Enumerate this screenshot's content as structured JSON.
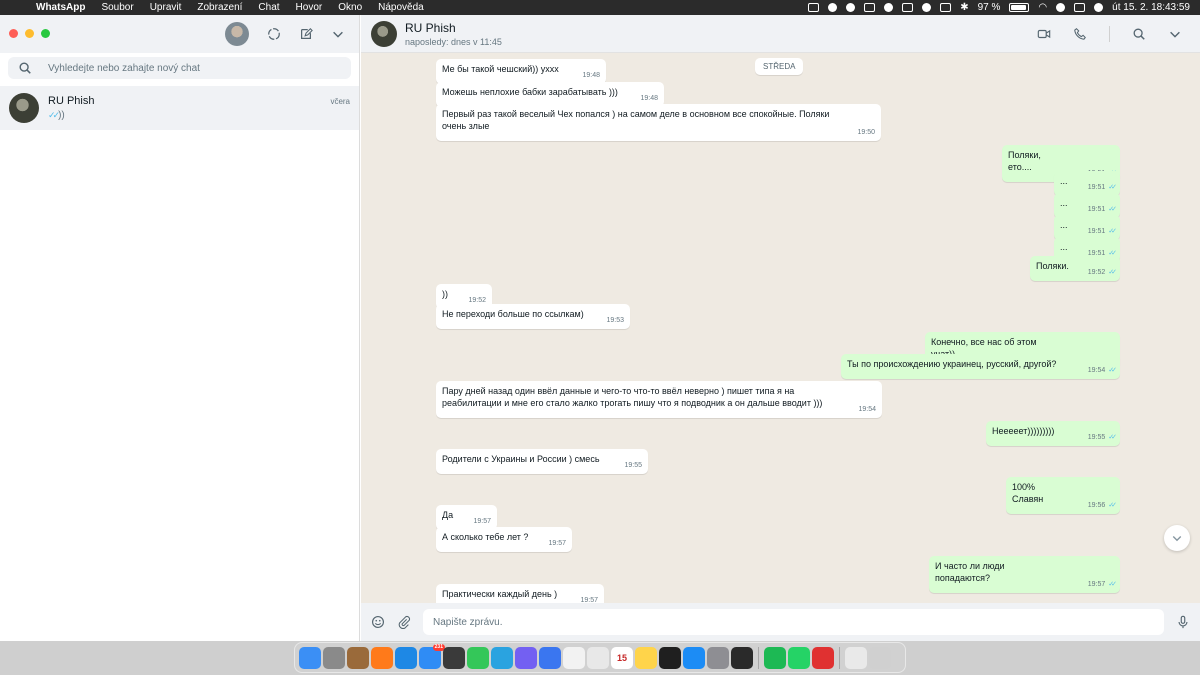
{
  "menubar": {
    "app": "WhatsApp",
    "items": [
      "Soubor",
      "Upravit",
      "Zobrazení",
      "Chat",
      "Hovor",
      "Okno",
      "Nápověda"
    ],
    "battery": "97 %",
    "datetime": "út 15. 2.  18:43:59"
  },
  "sidebar": {
    "search_placeholder": "Vyhledejte nebo zahajte nový chat",
    "chats": [
      {
        "name": "RU Phish",
        "time": "včera",
        "ticks": "✓✓",
        "preview": "))"
      }
    ]
  },
  "chat": {
    "contact_name": "RU Phish",
    "contact_status": "naposledy: dnes v 11:45",
    "day_separator": "STŘEDA",
    "composer_placeholder": "Napište zprávu.",
    "messages": [
      {
        "dir": "in",
        "text": "Ме бы такой чешский)) ухxx",
        "time": "19:48"
      },
      {
        "dir": "in",
        "text": "Можешь неплохие бабки зарабатывать )))",
        "time": "19:48"
      },
      {
        "dir": "in",
        "text": "Первый раз такой веселый Чех попался ) на самом деле в основном все спокойные. Поляки очень злые",
        "time": "19:50"
      },
      {
        "dir": "out",
        "text": "Поляки, ето....",
        "time": "19:51",
        "ticks": "✓✓"
      },
      {
        "dir": "out",
        "text": "...",
        "time": "19:51",
        "ticks": "✓✓"
      },
      {
        "dir": "out",
        "text": "...",
        "time": "19:51",
        "ticks": "✓✓"
      },
      {
        "dir": "out",
        "text": "...",
        "time": "19:51",
        "ticks": "✓✓"
      },
      {
        "dir": "out",
        "text": "...",
        "time": "19:51",
        "ticks": "✓✓"
      },
      {
        "dir": "out",
        "text": "Поляки.",
        "time": "19:52",
        "ticks": "✓✓"
      },
      {
        "dir": "in",
        "text": "))",
        "time": "19:52"
      },
      {
        "dir": "in",
        "text": "Не переходи больше по ссылкам)",
        "time": "19:53"
      },
      {
        "dir": "out",
        "text": "Конечно, все нас об этом учат))",
        "time": "19:54",
        "ticks": "✓✓"
      },
      {
        "dir": "out",
        "text": "Ты по происхождению украинец, русский, другой?",
        "time": "19:54",
        "ticks": "✓✓"
      },
      {
        "dir": "in",
        "text": "Пару дней назад один ввёл данные и чего-то что-то ввёл неверно ) пишет типа я на реабилитации и мне его стало жалко трогать пишу что я подводник а он дальше вводит )))",
        "time": "19:54"
      },
      {
        "dir": "out",
        "text": "Нееееет)))))))))",
        "time": "19:55",
        "ticks": "✓✓"
      },
      {
        "dir": "in",
        "text": "Родители с Украины и России ) смесь",
        "time": "19:55"
      },
      {
        "dir": "out",
        "text": "100% Славян",
        "time": "19:56",
        "ticks": "✓✓"
      },
      {
        "dir": "in",
        "text": "Да",
        "time": "19:57"
      },
      {
        "dir": "in",
        "text": "А сколько тебе лет ?",
        "time": "19:57"
      },
      {
        "dir": "out",
        "text": "И часто ли люди попадаются?",
        "time": "19:57",
        "ticks": "✓✓"
      },
      {
        "dir": "in",
        "text": "Практически каждый день )",
        "time": "19:57"
      }
    ]
  },
  "dock": {
    "apps": [
      {
        "name": "finder",
        "color": "#3b8ff5",
        "glyph": ""
      },
      {
        "name": "launchpad",
        "color": "#8a8a8a",
        "glyph": ""
      },
      {
        "name": "photo-app",
        "color": "#9a6a3a",
        "glyph": ""
      },
      {
        "name": "firefox",
        "color": "#ff7a1a",
        "glyph": ""
      },
      {
        "name": "safari",
        "color": "#1e88e5",
        "glyph": ""
      },
      {
        "name": "mail",
        "color": "#2f8cf5",
        "glyph": "",
        "badge": "231"
      },
      {
        "name": "calculator",
        "color": "#3a3a3a",
        "glyph": ""
      },
      {
        "name": "messages",
        "color": "#34c759",
        "glyph": ""
      },
      {
        "name": "telegram",
        "color": "#2aa3e0",
        "glyph": ""
      },
      {
        "name": "viber",
        "color": "#7360f2",
        "glyph": ""
      },
      {
        "name": "signal",
        "color": "#3a76f0",
        "glyph": ""
      },
      {
        "name": "reminders",
        "color": "#f2f2f2",
        "glyph": ""
      },
      {
        "name": "notes-draw",
        "color": "#e8e8e8",
        "glyph": ""
      },
      {
        "name": "calendar",
        "color": "#ffffff",
        "glyph": "15"
      },
      {
        "name": "notes",
        "color": "#ffd44a",
        "glyph": ""
      },
      {
        "name": "chatgpt",
        "color": "#1f1f1f",
        "glyph": ""
      },
      {
        "name": "app-store",
        "color": "#1c8cf5",
        "glyph": ""
      },
      {
        "name": "system-settings",
        "color": "#8e8e93",
        "glyph": ""
      },
      {
        "name": "app-black",
        "color": "#2a2a2a",
        "glyph": ""
      },
      {
        "name": "spotify",
        "color": "#1db954",
        "glyph": ""
      },
      {
        "name": "whatsapp",
        "color": "#25d366",
        "glyph": ""
      },
      {
        "name": "app-red",
        "color": "#e03131",
        "glyph": ""
      },
      {
        "name": "downloads",
        "color": "#e9e9e9",
        "glyph": ""
      },
      {
        "name": "trash",
        "color": "#d0d0d0",
        "glyph": ""
      }
    ]
  }
}
